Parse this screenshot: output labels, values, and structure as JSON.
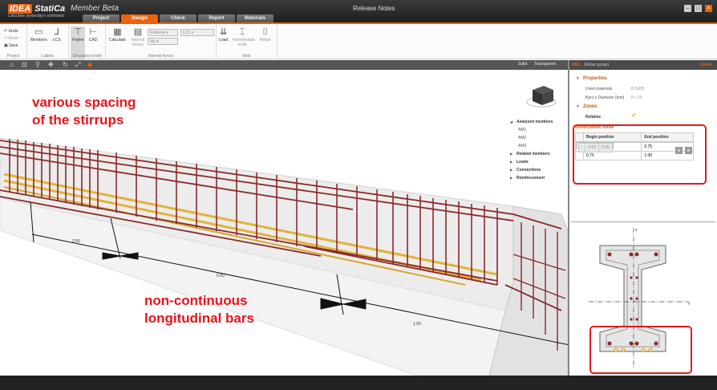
{
  "titlebar": {
    "logo_idea": "IDEA",
    "logo_statica": "StatiCa",
    "app_name": "Member Beta",
    "tagline": "Calculate yesterday's estimates",
    "release_notes": "Release Notes",
    "tabs": [
      "Project",
      "Design",
      "Check",
      "Report",
      "Materials"
    ],
    "active_tab": "Design"
  },
  "ribbon": {
    "project": {
      "undo": "Undo",
      "redo": "Redo",
      "save": "Save",
      "group_label": "Project"
    },
    "labels": {
      "members": "Members",
      "lcs": "LCS",
      "group_label": "Labels"
    },
    "structural_model": {
      "frame": "Frame",
      "cad": "CAD",
      "group_label": "Structural model"
    },
    "internal_forces": {
      "calculate": "Calculate",
      "internal_forces": "Internal forces",
      "extreme": "Extreme",
      "load": "LC1",
      "my": "My",
      "group_label": "Internal forces"
    },
    "new": {
      "load": "Load",
      "intermediate_node": "Intermediate node",
      "rebar": "Rebar",
      "group_label": "New"
    }
  },
  "viewport_toolbar": {
    "solid": "Solid",
    "transparent": "Transparent"
  },
  "viewport": {
    "callout_top": [
      "various spacing",
      "of the stirrups"
    ],
    "callout_bottom": [
      "non-continuous",
      "longitudinal bars"
    ],
    "dims": [
      "2.50",
      "5.00",
      "1.00"
    ],
    "tree": {
      "analyzed_members": "Analyzed members",
      "members": [
        "AM1",
        "AM2",
        "AM3"
      ],
      "related_members": "Related members",
      "loads": "Loads",
      "connections": "Connections",
      "reinforcement": "Reinforcement"
    }
  },
  "panel": {
    "id": "RB2",
    "group": "(Rebar group)",
    "delete": "Delete",
    "properties_title": "Properties",
    "used_materials_label": "Used materials",
    "used_materials_value": "B 500B",
    "bars_label": "Bars x Diameter [mm]",
    "bars_value": "8 x 16",
    "zones_title": "Zones",
    "relative_label": "Relative",
    "relative_check": "✓",
    "reinforcement_zones_title": "Reinforcement zones",
    "zones_columns": [
      "Begin position",
      "End position"
    ],
    "zones_rows": [
      {
        "begin": "0.00",
        "end": "0.25"
      },
      {
        "begin": "0.25",
        "end": "0.75"
      },
      {
        "begin": "0.75",
        "end": "1.00"
      }
    ],
    "section": {
      "z_axis": "z",
      "y_axis": "y"
    }
  },
  "colors": {
    "accent": "#e9630f",
    "highlight": "#e01b1b",
    "rebar": "#8b2a2a",
    "bar_yellow": "#e2b33a"
  }
}
